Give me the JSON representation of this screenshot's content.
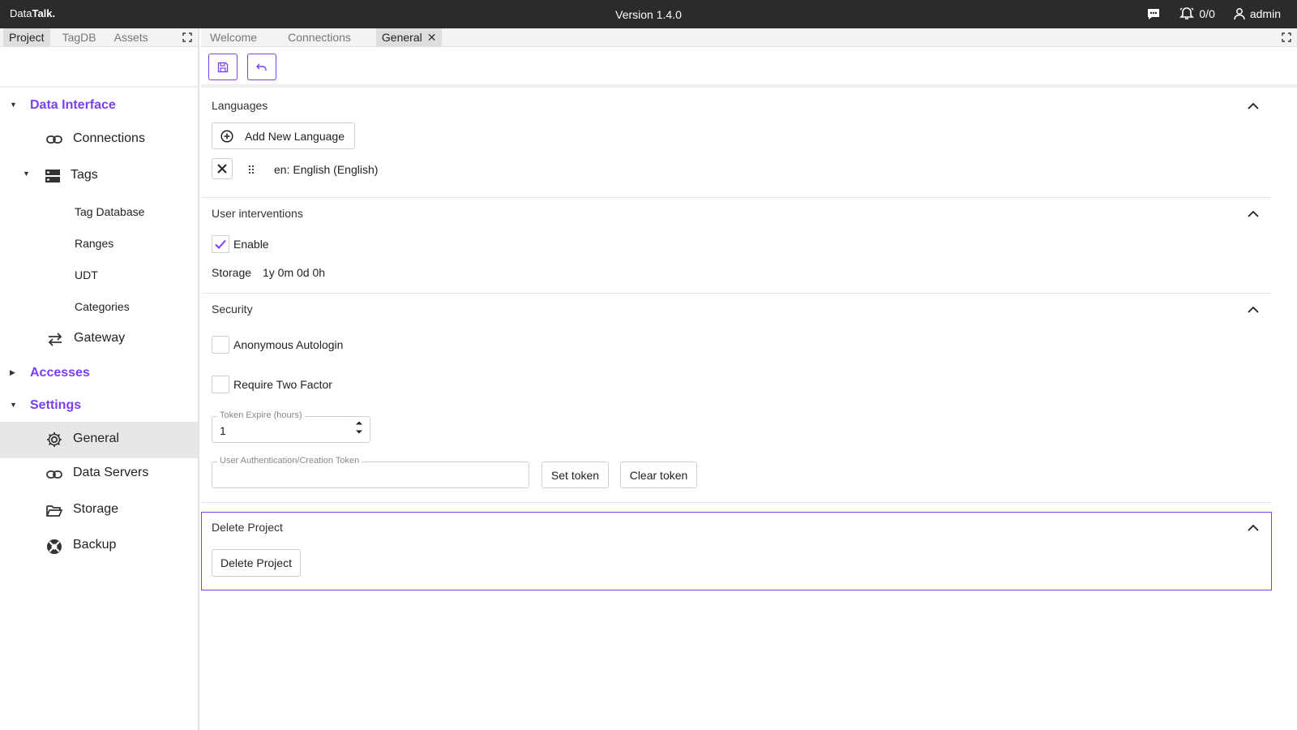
{
  "topbar": {
    "brand_light": "Data",
    "brand_bold": "Talk.",
    "version": "Version 1.4.0",
    "alarm_count": "0/0",
    "user": "admin"
  },
  "left": {
    "tabs": [
      "Project",
      "TagDB",
      "Assets"
    ],
    "tree": {
      "data_interface": "Data Interface",
      "connections": "Connections",
      "tags": "Tags",
      "tag_database": "Tag Database",
      "ranges": "Ranges",
      "udt": "UDT",
      "categories": "Categories",
      "gateway": "Gateway",
      "accesses": "Accesses",
      "settings": "Settings",
      "general": "General",
      "data_servers": "Data Servers",
      "storage": "Storage",
      "backup": "Backup"
    }
  },
  "right": {
    "tabs": [
      "Welcome",
      "Connections",
      "General"
    ]
  },
  "languages": {
    "title": "Languages",
    "add_button": "Add New Language",
    "item": "en: English (English)"
  },
  "interventions": {
    "title": "User interventions",
    "enable_label": "Enable",
    "storage_label": "Storage",
    "storage_value": "1y 0m 0d 0h"
  },
  "security": {
    "title": "Security",
    "anon_label": "Anonymous Autologin",
    "twofactor_label": "Require Two Factor",
    "token_expire_label": "Token Expire (hours)",
    "token_expire_value": "1",
    "auth_token_label": "User Authentication/Creation Token",
    "set_token": "Set token",
    "clear_token": "Clear token"
  },
  "delete": {
    "title": "Delete Project",
    "button": "Delete Project"
  },
  "colors": {
    "accent": "#7b3ff2",
    "topbar": "#2b2b2b",
    "selected_bg": "#e7e7e7"
  }
}
